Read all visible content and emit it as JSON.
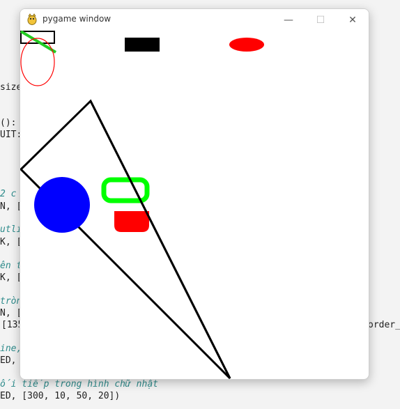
{
  "window": {
    "title": "pygame window",
    "minimize_label": "—",
    "maximize_label": "☐",
    "close_label": "✕"
  },
  "background_code": [
    {
      "text": "size",
      "comment": false
    },
    {
      "text": "():",
      "comment": false
    },
    {
      "text": "UIT:",
      "comment": false
    },
    {
      "text": "2 c",
      "comment": true
    },
    {
      "text": "N, [",
      "comment": false
    },
    {
      "text": "utlin",
      "comment": true
    },
    {
      "text": "K, [",
      "comment": false
    },
    {
      "text": "ên t",
      "comment": true
    },
    {
      "text": "K, [",
      "comment": false
    },
    {
      "text": "tròn",
      "comment": true
    },
    {
      "text": "N, [",
      "comment": false
    },
    {
      "text": "[135",
      "comment": false
    },
    {
      "text": "order_",
      "comment": false
    },
    {
      "text": "ine,",
      "comment": true
    },
    {
      "text": "ED,",
      "comment": false
    },
    {
      "text": "ối tiếp trong hình chữ nhật",
      "comment": true
    },
    {
      "text": "ED, [300, 10, 50, 20])",
      "comment": false
    }
  ],
  "colors": {
    "black": "#000000",
    "red": "#ff0000",
    "green": "#00ff00",
    "blue": "#0000ff",
    "bright_green_line": "#22cc22"
  }
}
